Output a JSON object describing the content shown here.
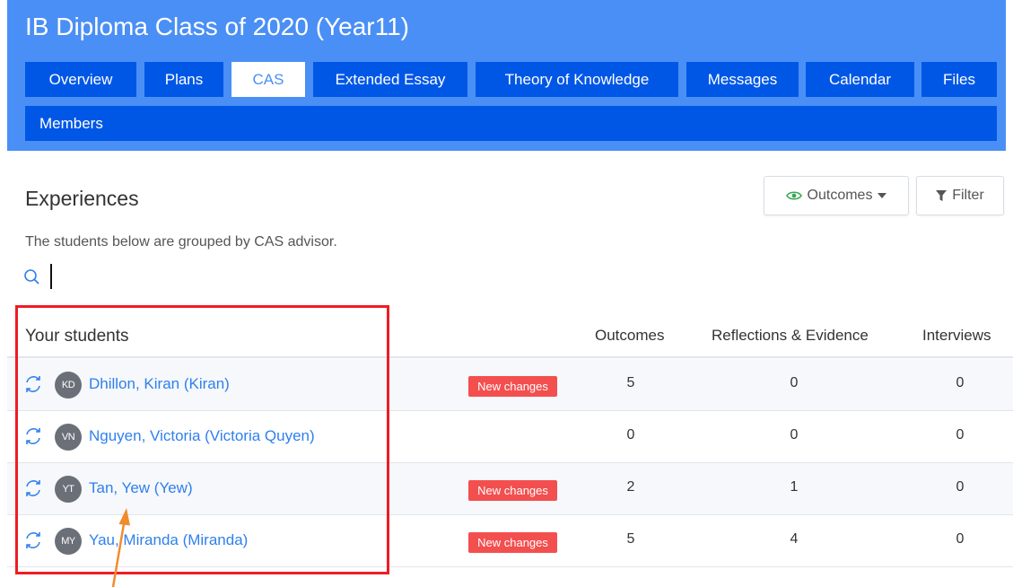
{
  "header": {
    "title": "IB Diploma Class of 2020 (Year11)",
    "tabs": [
      {
        "label": "Overview"
      },
      {
        "label": "Plans"
      },
      {
        "label": "CAS"
      },
      {
        "label": "Extended Essay"
      },
      {
        "label": "Theory of Knowledge"
      },
      {
        "label": "Messages"
      },
      {
        "label": "Calendar"
      },
      {
        "label": "Files"
      },
      {
        "label": "Members"
      }
    ],
    "active_tab": "CAS"
  },
  "section": {
    "title": "Experiences",
    "subtitle": "The students below are grouped by CAS advisor."
  },
  "toolbar": {
    "outcomes_label": "Outcomes",
    "filter_label": "Filter"
  },
  "search": {
    "value": "",
    "placeholder": ""
  },
  "table": {
    "group_label": "Your students",
    "columns": [
      "Outcomes",
      "Reflections & Evidence",
      "Interviews"
    ],
    "rows": [
      {
        "initials": "KD",
        "name": "Dhillon, Kiran (Kiran)",
        "badge": "New changes",
        "outcomes": "5",
        "reflections": "0",
        "interviews": "0"
      },
      {
        "initials": "VN",
        "name": "Nguyen, Victoria (Victoria Quyen)",
        "badge": "",
        "outcomes": "0",
        "reflections": "0",
        "interviews": "0"
      },
      {
        "initials": "YT",
        "name": "Tan, Yew (Yew)",
        "badge": "New changes",
        "outcomes": "2",
        "reflections": "1",
        "interviews": "0"
      },
      {
        "initials": "MY",
        "name": "Yau, Miranda (Miranda)",
        "badge": "New changes",
        "outcomes": "5",
        "reflections": "4",
        "interviews": "0"
      }
    ]
  },
  "colors": {
    "header_bg": "#4a8ff5",
    "tab_bg": "#0057e6",
    "link": "#2f80ed",
    "badge": "#f34f4f",
    "highlight_box": "#ef1c25",
    "arrow": "#f08c2e"
  }
}
